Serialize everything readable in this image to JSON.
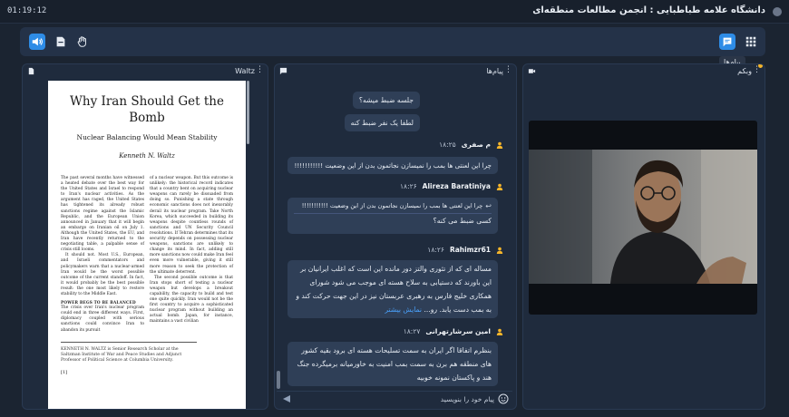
{
  "window": {
    "timer": "01:19:12",
    "title": "دانشگاه علامه طباطبایی : انجمن مطالعات منطقه‌ای"
  },
  "toolbar": {
    "chat_tooltip": "پیام‌ها",
    "icons": [
      "speaker-icon",
      "files-icon",
      "hand-icon",
      "chat-icon",
      "grid-icon"
    ],
    "accent": "#2e8ce6"
  },
  "doc_panel": {
    "header_label": "Waltz",
    "title": "Why Iran Should Get the Bomb",
    "subtitle": "Nuclear Balancing Would Mean Stability",
    "author": "Kenneth N. Waltz",
    "col1_p1": "The past several months have witnessed a heated debate over the best way for the United States and Israel to respond to Iran's nuclear activities. As the argument has raged, the United States has tightened its already robust sanctions regime against the Islamic Republic, and the European Union announced in January that it will begin an embargo on Iranian oil on July 1. Although the United States, the EU, and Iran have recently returned to the negotiating table, a palpable sense of crisis still looms.",
    "col1_p2": "It should not. Most U.S., European, and Israeli commentators and policymakers warn that a nuclear-armed Iran would be the worst possible outcome of the current standoff. In fact, it would probably be the best possible result: the one most likely to restore stability to the Middle East.",
    "col1_section": "POWER BEGS TO BE BALANCED",
    "col1_p3": "The crisis over Iran's nuclear program could end in three different ways. First, diplomacy coupled with serious sanctions could convince Iran to abandon its pursuit",
    "col2_p1": "of a nuclear weapon. But this outcome is unlikely: the historical record indicates that a country bent on acquiring nuclear weapons can rarely be dissuaded from doing so. Punishing a state through economic sanctions does not inexorably derail its nuclear program. Take North Korea, which succeeded in building its weapons despite countless rounds of sanctions and UN Security Council resolutions. If Tehran determines that its security depends on possessing nuclear weapons, sanctions are unlikely to change its mind. In fact, adding still more sanctions now could make Iran feel even more vulnerable, giving it still more reason to seek the protection of the ultimate deterrent.",
    "col2_p2": "The second possible outcome is that Iran stops short of testing a nuclear weapon but develops a breakout capability, the capacity to build and test one quite quickly. Iran would not be the first country to acquire a sophisticated nuclear program without building an actual bomb. Japan, for instance, maintains a vast civilian",
    "footnote": "KENNETH N. WALTZ is Senior Research Scholar at the Saltzman Institute of War and Peace Studies and Adjunct Professor of Political Science at Columbia University.",
    "page_number": "[1]"
  },
  "chat_panel": {
    "header_label": "پیام‌ها",
    "messages": {
      "m1": "جلسه ضبط میشه؟",
      "m2": "لطفا یک نفر ضبط کنه",
      "u1_name": "م صفری",
      "u1_time": "۱۸:۲۵",
      "u1_text": "چرا این لعنتی ها بمب را نمیسازن نجاتمون بدن از این وضعیت !!!!!!!!!!!",
      "u2_name": "Alireza Baratiniya",
      "u2_time": "۱۸:۲۶",
      "u2_quote": "چرا این لعنتی ها بمب را نمیسازن نجاتمون بدن از این وضعیت !!!!!!!!!!!",
      "u2_text": "کسی ضبط می کنه؟",
      "u3_name": "Rahimzr61",
      "u3_time": "۱۸:۲۶",
      "u3_text": "مساله ای که از تئوری والتز دور مانده این است که اغلب ایرانیان بر این باورند که دستیابی به سلاح هسته ای موجب می شود شورای همکاری خلیج فارس به رهبری عربستان نیز در این جهت حرکت کند و به بمب دست یابد. رو...",
      "u3_more": "نمایش بیشتر",
      "u4_name": "امین سرشارتهرانی",
      "u4_time": "۱۸:۲۷",
      "u4_text": "بنظرم اتفاقا اگر ایران به سمت تسلیحات هسته ای برود بقیه کشور های منطقه هم برن به سمت بمب امنیت به خاورمیانه برمیگرده جنگ هند و پاکستان نمونه خوبیه"
    },
    "input_placeholder": "پیام خود را بنویسید"
  },
  "cam_panel": {
    "header_label": "وبکم"
  }
}
